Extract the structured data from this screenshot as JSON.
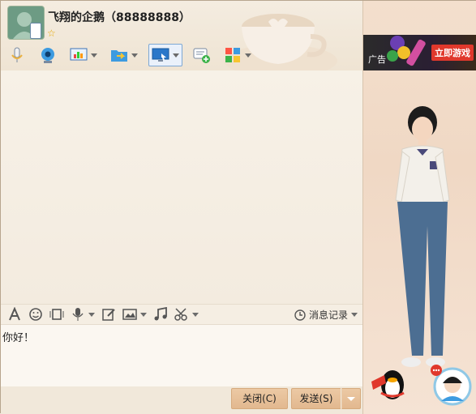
{
  "window": {
    "title": "飞翔的企鹅（88888888）",
    "star_icon": "star-icon",
    "controls": [
      "chevron-down-icon",
      "minimize-icon",
      "maximize-icon",
      "close-icon"
    ]
  },
  "toolbar": {
    "items": [
      {
        "icon": "microphone-icon"
      },
      {
        "icon": "webcam-icon"
      },
      {
        "icon": "presentation-icon"
      },
      {
        "icon": "folder-transfer-icon"
      },
      {
        "icon": "remote-desktop-icon"
      },
      {
        "icon": "add-chat-icon"
      },
      {
        "icon": "apps-icon"
      }
    ]
  },
  "input_toolbar": {
    "items": [
      "font-icon",
      "emoji-icon",
      "screenshot-icon",
      "voice-icon",
      "edit-icon",
      "image-icon",
      "music-icon",
      "scissors-icon"
    ],
    "history_label": "消息记录"
  },
  "input": {
    "text": "你好！"
  },
  "buttons": {
    "close_label": "关闭(C)",
    "send_label": "发送(S)"
  },
  "ad": {
    "label": "广告",
    "cta": "立即游戏"
  },
  "colors": {
    "accent": "#e2b88f",
    "ad_button": "#e0382c"
  }
}
